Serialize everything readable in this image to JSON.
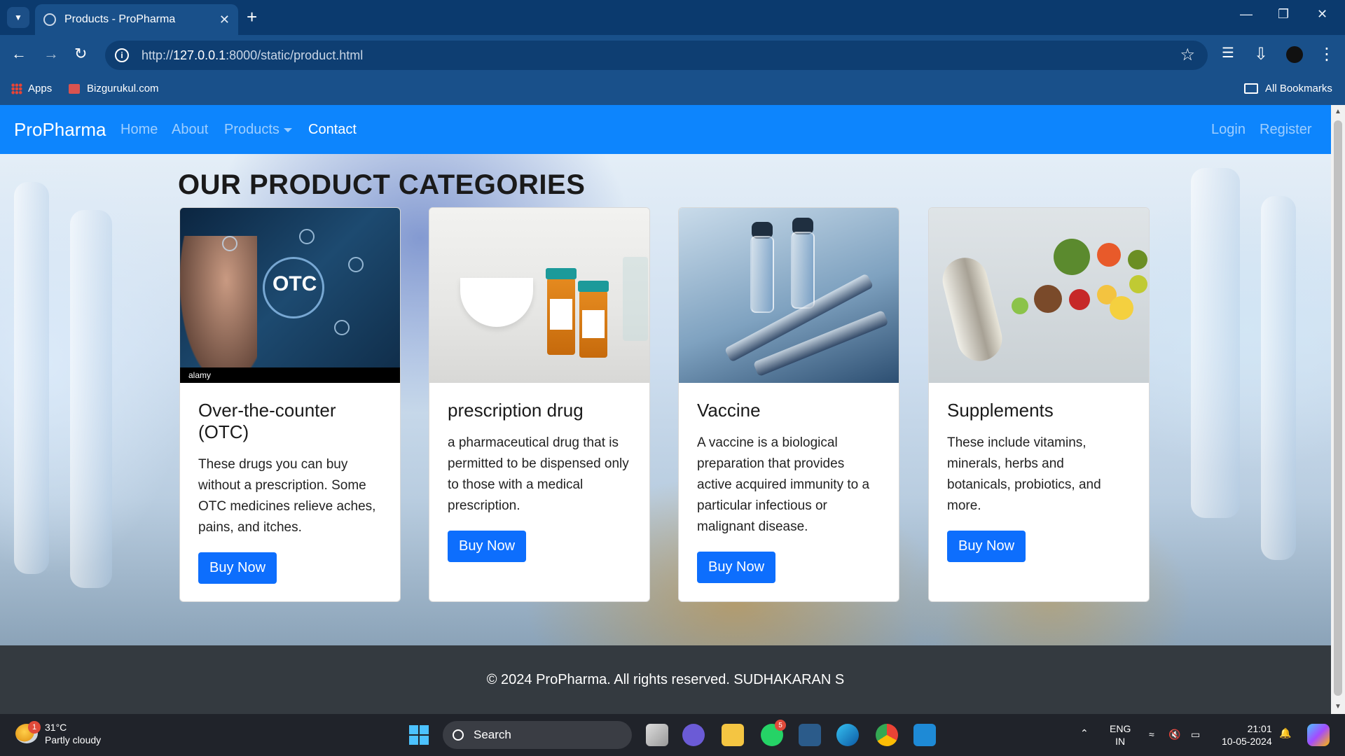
{
  "browser": {
    "tab_title": "Products - ProPharma",
    "url_prefix": "http://",
    "url_host": "127.0.0.1",
    "url_rest": ":8000/static/product.html",
    "bookmarks": [
      {
        "label": "Apps",
        "icon": "apps-grid-icon"
      },
      {
        "label": "Bizgurukul.com",
        "icon": "site-favicon"
      }
    ],
    "all_bookmarks": "All Bookmarks"
  },
  "navbar": {
    "brand": "ProPharma",
    "links": [
      "Home",
      "About",
      "Products",
      "Contact"
    ],
    "active": "Contact",
    "right_links": [
      "Login",
      "Register"
    ]
  },
  "page": {
    "heading": "OUR PRODUCT CATEGORIES",
    "cards": [
      {
        "title": "Over-the-counter (OTC)",
        "text": "These drugs you can buy without a prescription. Some OTC medicines relieve aches, pains, and itches.",
        "button": "Buy Now",
        "image_caption": "OTC",
        "watermark": "alamy"
      },
      {
        "title": "prescription drug",
        "text": "a pharmaceutical drug that is permitted to be dispensed only to those with a medical prescription.",
        "button": "Buy Now"
      },
      {
        "title": "Vaccine",
        "text": "A vaccine is a biological preparation that provides active acquired immunity to a particular infectious or malignant disease.",
        "button": "Buy Now"
      },
      {
        "title": "Supplements",
        "text": "These include vitamins, minerals, herbs and botanicals, probiotics, and more.",
        "button": "Buy Now"
      }
    ],
    "footer": "© 2024 ProPharma. All rights reserved. SUDHAKARAN S"
  },
  "taskbar": {
    "weather_temp": "31°C",
    "weather_desc": "Partly cloudy",
    "weather_badge": "1",
    "search_label": "Search",
    "whatsapp_badge": "5",
    "lang_top": "ENG",
    "lang_bottom": "IN",
    "time": "21:01",
    "date": "10-05-2024"
  },
  "colors": {
    "navbar": "#0d85fd",
    "button": "#0d6efd",
    "footer": "#343a40",
    "chrome": "#0b3a6e"
  }
}
